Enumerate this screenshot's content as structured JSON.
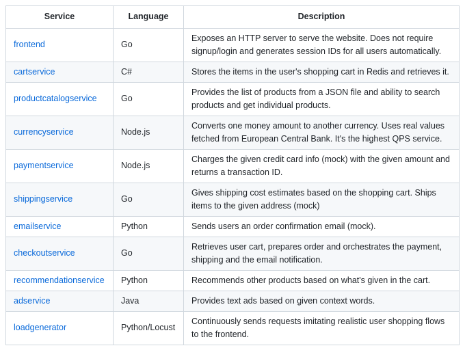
{
  "headers": {
    "service": "Service",
    "language": "Language",
    "description": "Description"
  },
  "rows": [
    {
      "service": "frontend",
      "language": "Go",
      "description": "Exposes an HTTP server to serve the website. Does not require signup/login and generates session IDs for all users automatically."
    },
    {
      "service": "cartservice",
      "language": "C#",
      "description": "Stores the items in the user's shopping cart in Redis and retrieves it."
    },
    {
      "service": "productcatalogservice",
      "language": "Go",
      "description": "Provides the list of products from a JSON file and ability to search products and get individual products."
    },
    {
      "service": "currencyservice",
      "language": "Node.js",
      "description": "Converts one money amount to another currency. Uses real values fetched from European Central Bank. It's the highest QPS service."
    },
    {
      "service": "paymentservice",
      "language": "Node.js",
      "description": "Charges the given credit card info (mock) with the given amount and returns a transaction ID."
    },
    {
      "service": "shippingservice",
      "language": "Go",
      "description": "Gives shipping cost estimates based on the shopping cart. Ships items to the given address (mock)"
    },
    {
      "service": "emailservice",
      "language": "Python",
      "description": "Sends users an order confirmation email (mock)."
    },
    {
      "service": "checkoutservice",
      "language": "Go",
      "description": "Retrieves user cart, prepares order and orchestrates the payment, shipping and the email notification."
    },
    {
      "service": "recommendationservice",
      "language": "Python",
      "description": "Recommends other products based on what's given in the cart."
    },
    {
      "service": "adservice",
      "language": "Java",
      "description": "Provides text ads based on given context words."
    },
    {
      "service": "loadgenerator",
      "language": "Python/Locust",
      "description": "Continuously sends requests imitating realistic user shopping flows to the frontend."
    }
  ]
}
